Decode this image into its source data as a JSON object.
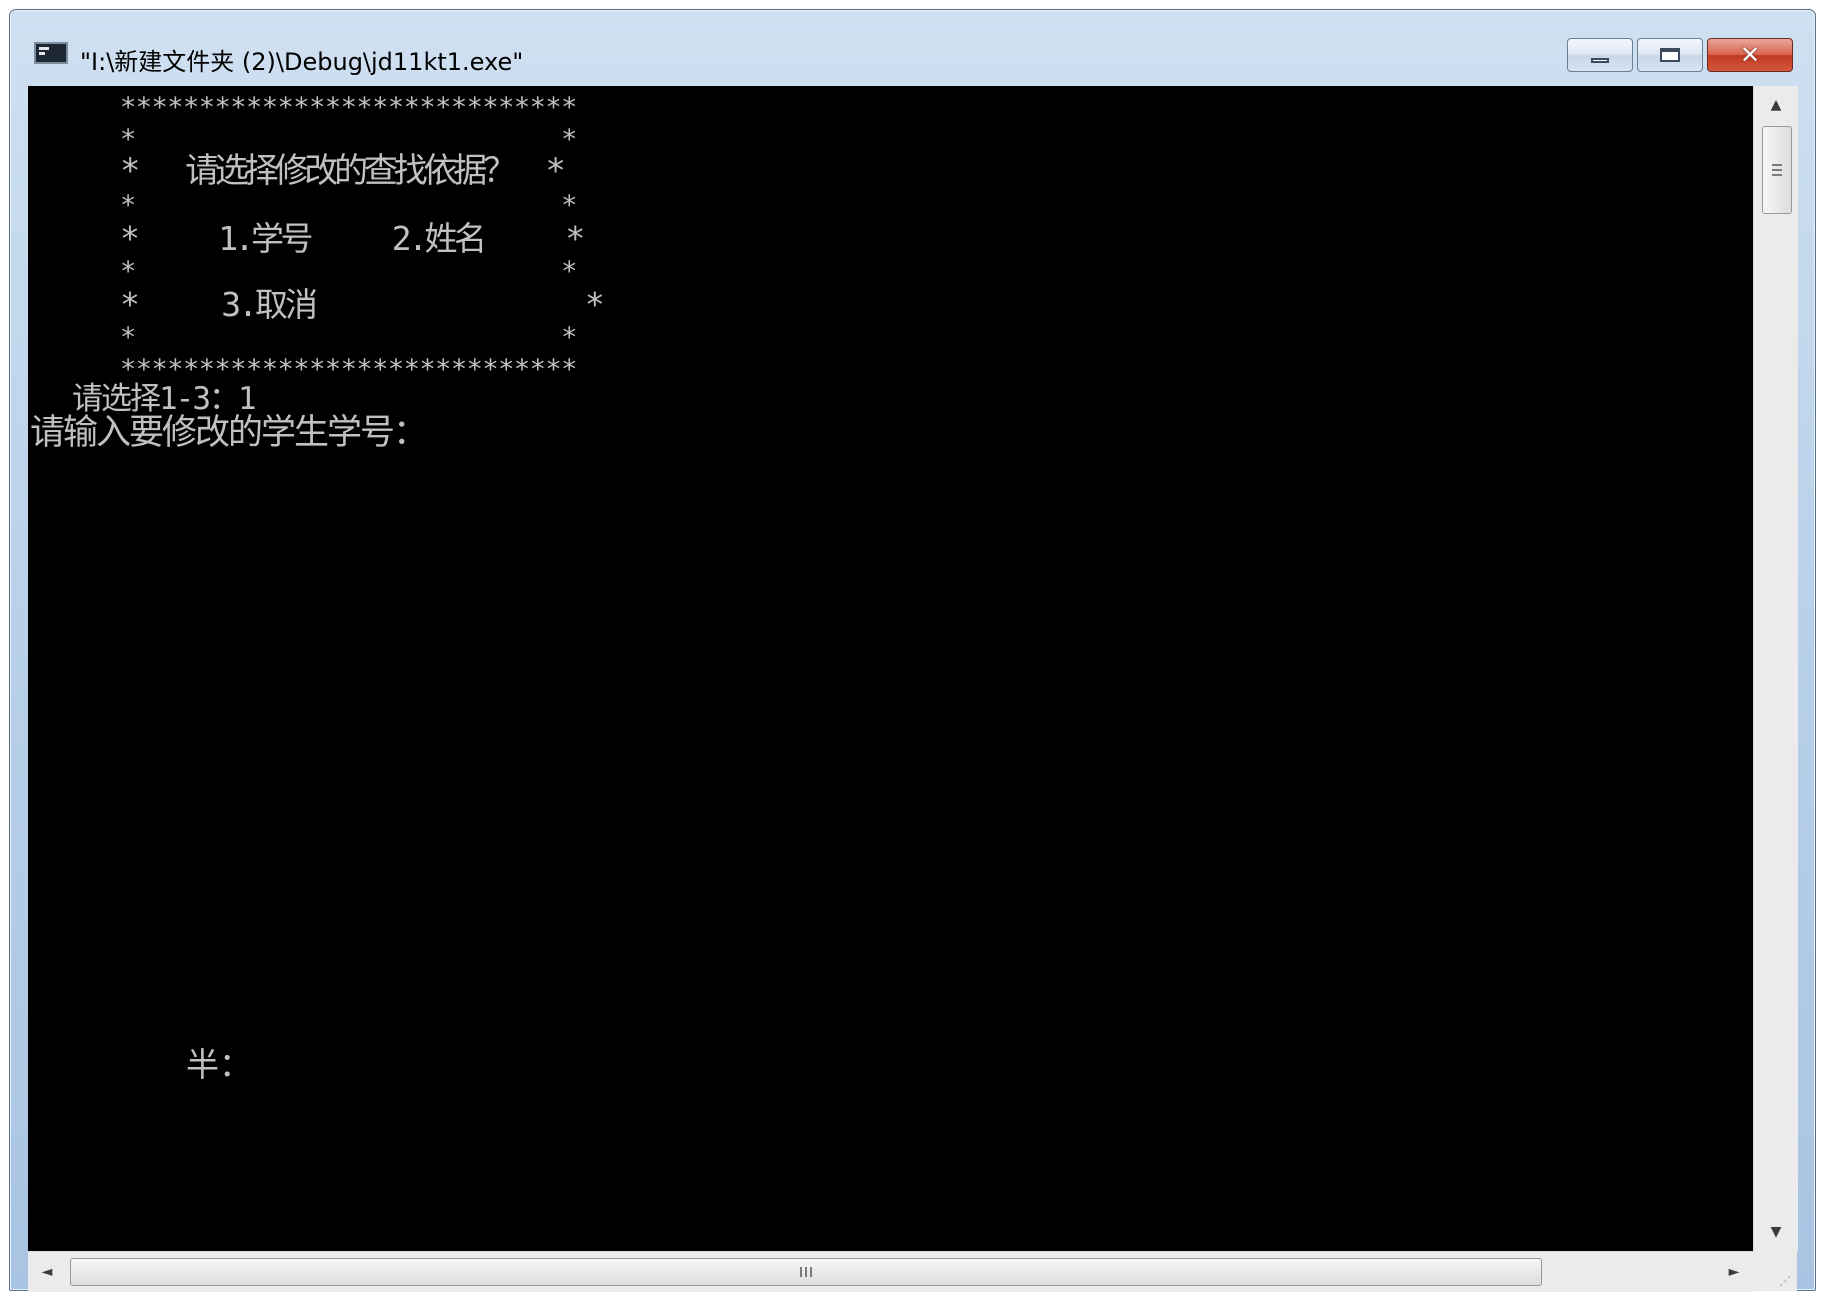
{
  "window": {
    "title": "\"I:\\新建文件夹 (2)\\Debug\\jd11kt1.exe\"",
    "icon": "console-app-icon",
    "buttons": {
      "minimize_icon": "minimize-icon",
      "maximize_icon": "maximize-icon",
      "close_label": "✕"
    }
  },
  "console": {
    "background": "#000000",
    "foreground": "#c0c0c0",
    "menu": {
      "border_top": "*****************************",
      "empty_row": "*                           *",
      "question_row": "*   请选择修改的查找依据？  *",
      "options_row_1": "*     1.学号     2.姓名     *",
      "options_row_2": "*     3.取消                *",
      "border_bottom": "*****************************"
    },
    "choice_prompt": "请选择1-3：1",
    "input_prompt": "请输入要修改的学生学号：",
    "ime_status": "半："
  },
  "scrollbars": {
    "up_arrow": "▲",
    "down_arrow": "▼",
    "left_arrow": "◄",
    "right_arrow": "►",
    "size_grip": "⋰"
  }
}
